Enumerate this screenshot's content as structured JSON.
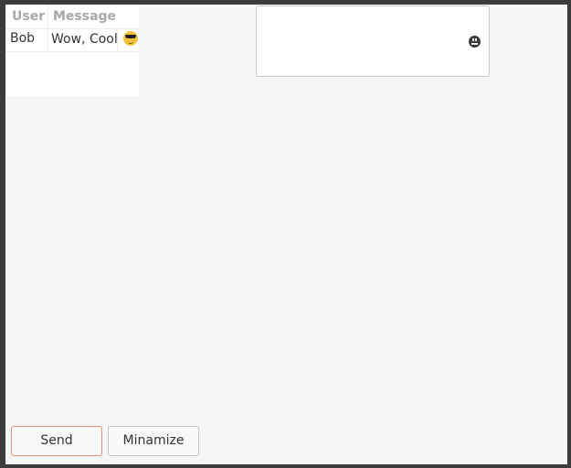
{
  "table": {
    "headers": {
      "user": "User",
      "message": "Message"
    },
    "rows": [
      {
        "user": "Bob",
        "message": "Wow, Cool",
        "emoji": "sunglasses-emoji-icon"
      }
    ]
  },
  "input": {
    "value": "",
    "emoji_button_icon": "emoji-smiley-icon"
  },
  "buttons": {
    "send_label": "Send",
    "minimize_label": "Minamize"
  },
  "colors": {
    "send_border": "#e8927a",
    "background": "#f6f6f6"
  }
}
